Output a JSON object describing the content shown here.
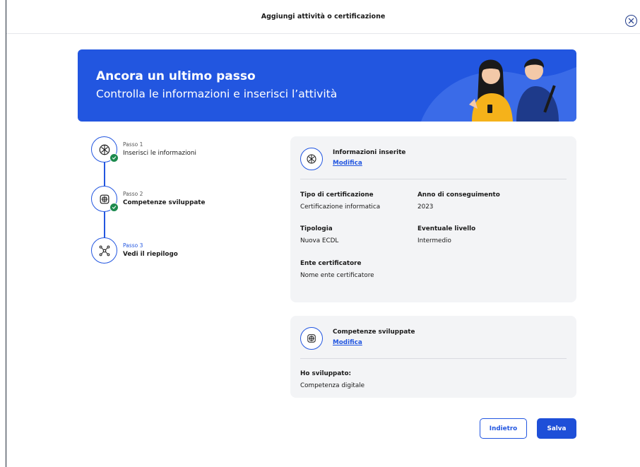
{
  "header": {
    "title": "Aggiungi attività o certificazione"
  },
  "banner": {
    "title": "Ancora un ultimo passo",
    "subtitle": "Controlla le informazioni e inserisci l’attività"
  },
  "stepper": {
    "steps": [
      {
        "small": "Passo 1",
        "label": "Inserisci le informazioni",
        "done": true
      },
      {
        "small": "Passo 2",
        "label": "Competenze sviluppate",
        "done": true
      },
      {
        "small": "Passo 3",
        "label": "Vedi il riepilogo",
        "done": false
      }
    ]
  },
  "info_card": {
    "title": "Informazioni inserite",
    "link": "Modifica",
    "fields": [
      {
        "label": "Tipo di certificazione",
        "value": "Certificazione informatica"
      },
      {
        "label": "Anno di conseguimento",
        "value": "2023"
      },
      {
        "label": "Tipologia",
        "value": "Nuova ECDL"
      },
      {
        "label": "Eventuale livello",
        "value": "Intermedio"
      },
      {
        "label": "Ente certificatore",
        "value": "Nome ente certificatore"
      }
    ]
  },
  "skills_card": {
    "title": "Competenze sviluppate",
    "link": "Modifica",
    "fields": [
      {
        "label": "Ho sviluppato:",
        "value": "Competenza digitale"
      }
    ]
  },
  "actions": {
    "back": "Indietro",
    "save": "Salva"
  },
  "colors": {
    "primary": "#2256e0",
    "success": "#1d8a4e",
    "card_bg": "#f3f4f6"
  },
  "icons": {
    "close": "close-circle-icon",
    "step1": "cube-icon",
    "step2": "puzzle-icon",
    "step3": "network-icon",
    "check": "check-icon"
  }
}
